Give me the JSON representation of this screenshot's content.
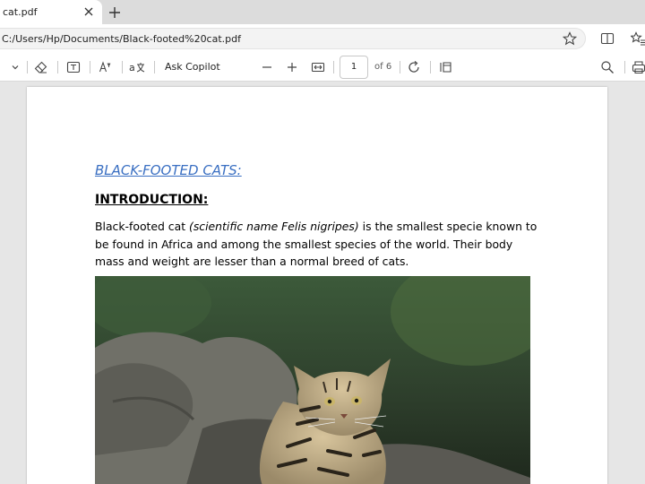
{
  "tab": {
    "title": "cat.pdf"
  },
  "address_bar": {
    "url": "C:/Users/Hp/Documents/Black-footed%20cat.pdf"
  },
  "pdf_toolbar": {
    "ask_copilot": "Ask Copilot",
    "page_number": "1",
    "page_total": "of 6"
  },
  "document": {
    "title": "BLACK-FOOTED CATS:",
    "heading": "INTRODUCTION:",
    "para_part1": "Black-footed cat ",
    "para_italic": "(scientific name Felis nigripes)",
    "para_part2": " is the smallest specie known to be found in Africa and among the smallest species of the world. Their body mass and weight are lesser than a normal breed of cats."
  },
  "icons": {
    "tab_close": "close-icon",
    "new_tab": "plus-icon",
    "favorite": "star-icon",
    "split": "split-screen-icon",
    "favorites": "favorites-icon",
    "dropdown": "chevron-down-icon",
    "erase": "eraser-icon",
    "text": "text-box-icon",
    "read_aloud": "read-aloud-icon",
    "translate": "translate-icon",
    "zoom_out": "minus-icon",
    "zoom_in": "plus-icon",
    "fit": "fit-width-icon",
    "rotate": "rotate-icon",
    "page_view": "page-view-icon",
    "search": "search-icon",
    "print": "print-icon"
  },
  "colors": {
    "accent_link": "#3a6fc2",
    "tab_strip": "#dcdcdc",
    "viewport_bg": "#e6e6e6"
  }
}
